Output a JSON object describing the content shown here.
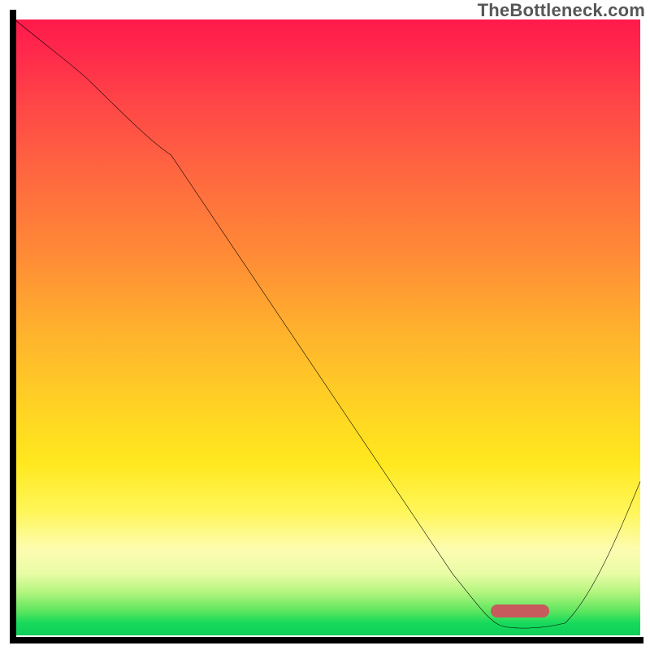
{
  "watermark": "TheBottleneck.com",
  "chart_data": {
    "type": "line",
    "title": "",
    "xlabel": "",
    "ylabel": "",
    "xlim": [
      0,
      100
    ],
    "ylim": [
      0,
      100
    ],
    "background_gradient": [
      {
        "stop": 0,
        "color": "#ff1a4b"
      },
      {
        "stop": 50,
        "color": "#ffb02e"
      },
      {
        "stop": 80,
        "color": "#fff65a"
      },
      {
        "stop": 100,
        "color": "#0fcf5a"
      }
    ],
    "series": [
      {
        "name": "bottleneck-curve",
        "x": [
          0,
          12,
          25,
          40,
          55,
          70,
          78,
          82,
          88,
          100
        ],
        "y": [
          100,
          90,
          78,
          55,
          33,
          10,
          2,
          1,
          2,
          25
        ]
      }
    ],
    "marker": {
      "name": "optimal-range",
      "x_start": 76,
      "x_end": 85,
      "y": 1,
      "color": "#c65a5c"
    },
    "grid": false,
    "legend": false
  },
  "marker_style": "left:604px; top:744px;"
}
